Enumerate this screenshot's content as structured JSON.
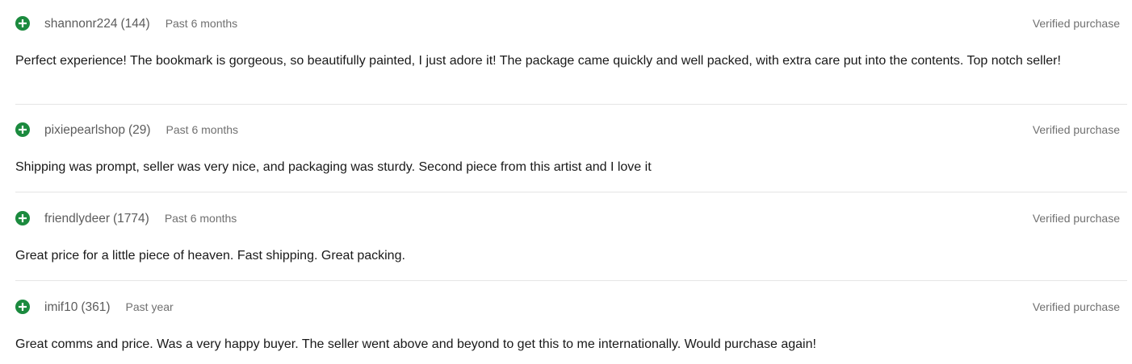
{
  "colors": {
    "positive_icon": "#1b8a3e",
    "reviewer_text": "#5c5c5c",
    "meta_text": "#707070",
    "comment_text": "#191919",
    "divider": "#e5e5e5"
  },
  "reviews": [
    {
      "icon": "plus-circle-icon",
      "username": "shannonr224",
      "score": "(144)",
      "timeframe": "Past 6 months",
      "verified": "Verified purchase",
      "comment": "Perfect experience! The bookmark is gorgeous, so beautifully painted, I just adore it! The package came quickly and well packed, with extra care put into the contents. Top notch seller!"
    },
    {
      "icon": "plus-circle-icon",
      "username": "pixiepearlshop",
      "score": "(29)",
      "timeframe": "Past 6 months",
      "verified": "Verified purchase",
      "comment": "Shipping was prompt, seller was very nice, and packaging was sturdy. Second piece from this artist and I love it"
    },
    {
      "icon": "plus-circle-icon",
      "username": "friendlydeer",
      "score": "(1774)",
      "timeframe": "Past 6 months",
      "verified": "Verified purchase",
      "comment": "Great price for a little piece of heaven. Fast shipping. Great packing."
    },
    {
      "icon": "plus-circle-icon",
      "username": "imif10",
      "score": "(361)",
      "timeframe": "Past year",
      "verified": "Verified purchase",
      "comment": "Great comms and price. Was a very happy buyer. The seller went above and beyond to get this to me internationally. Would purchase again!"
    }
  ]
}
